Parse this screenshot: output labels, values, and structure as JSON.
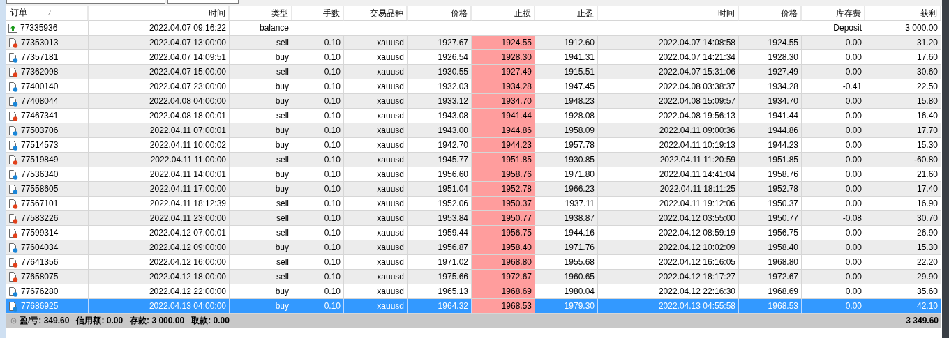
{
  "columns": [
    "订单",
    "时间",
    "类型",
    "手数",
    "交易品种",
    "价格",
    "止损",
    "止盈",
    "时间",
    "价格",
    "库存费",
    "获利"
  ],
  "rows": [
    {
      "kind": "balance",
      "selected": false,
      "order": "77335936",
      "open_time": "2022.04.07 09:16:22",
      "type": "balance",
      "comment": "Deposit",
      "profit": "3 000.00"
    },
    {
      "kind": "sell",
      "selected": false,
      "order": "77353013",
      "open_time": "2022.04.07 13:00:00",
      "type": "sell",
      "volume": "0.10",
      "symbol": "xauusd",
      "open_price": "1927.67",
      "stop_loss": "1924.55",
      "take_profit": "1912.60",
      "close_time": "2022.04.07 14:08:58",
      "close_price": "1924.55",
      "swap": "0.00",
      "profit": "31.20"
    },
    {
      "kind": "buy",
      "selected": false,
      "order": "77357181",
      "open_time": "2022.04.07 14:09:51",
      "type": "buy",
      "volume": "0.10",
      "symbol": "xauusd",
      "open_price": "1926.54",
      "stop_loss": "1928.30",
      "take_profit": "1941.31",
      "close_time": "2022.04.07 14:21:34",
      "close_price": "1928.30",
      "swap": "0.00",
      "profit": "17.60"
    },
    {
      "kind": "sell",
      "selected": false,
      "order": "77362098",
      "open_time": "2022.04.07 15:00:00",
      "type": "sell",
      "volume": "0.10",
      "symbol": "xauusd",
      "open_price": "1930.55",
      "stop_loss": "1927.49",
      "take_profit": "1915.51",
      "close_time": "2022.04.07 15:31:06",
      "close_price": "1927.49",
      "swap": "0.00",
      "profit": "30.60"
    },
    {
      "kind": "buy",
      "selected": false,
      "order": "77400140",
      "open_time": "2022.04.07 23:00:00",
      "type": "buy",
      "volume": "0.10",
      "symbol": "xauusd",
      "open_price": "1932.03",
      "stop_loss": "1934.28",
      "take_profit": "1947.45",
      "close_time": "2022.04.08 03:38:37",
      "close_price": "1934.28",
      "swap": "-0.41",
      "profit": "22.50"
    },
    {
      "kind": "buy",
      "selected": false,
      "order": "77408044",
      "open_time": "2022.04.08 04:00:00",
      "type": "buy",
      "volume": "0.10",
      "symbol": "xauusd",
      "open_price": "1933.12",
      "stop_loss": "1934.70",
      "take_profit": "1948.23",
      "close_time": "2022.04.08 15:09:57",
      "close_price": "1934.70",
      "swap": "0.00",
      "profit": "15.80"
    },
    {
      "kind": "sell",
      "selected": false,
      "order": "77467341",
      "open_time": "2022.04.08 18:00:01",
      "type": "sell",
      "volume": "0.10",
      "symbol": "xauusd",
      "open_price": "1943.08",
      "stop_loss": "1941.44",
      "take_profit": "1928.08",
      "close_time": "2022.04.08 19:56:13",
      "close_price": "1941.44",
      "swap": "0.00",
      "profit": "16.40"
    },
    {
      "kind": "buy",
      "selected": false,
      "order": "77503706",
      "open_time": "2022.04.11 07:00:01",
      "type": "buy",
      "volume": "0.10",
      "symbol": "xauusd",
      "open_price": "1943.00",
      "stop_loss": "1944.86",
      "take_profit": "1958.09",
      "close_time": "2022.04.11 09:00:36",
      "close_price": "1944.86",
      "swap": "0.00",
      "profit": "17.70"
    },
    {
      "kind": "buy",
      "selected": false,
      "order": "77514573",
      "open_time": "2022.04.11 10:00:02",
      "type": "buy",
      "volume": "0.10",
      "symbol": "xauusd",
      "open_price": "1942.70",
      "stop_loss": "1944.23",
      "take_profit": "1957.78",
      "close_time": "2022.04.11 10:19:13",
      "close_price": "1944.23",
      "swap": "0.00",
      "profit": "15.30"
    },
    {
      "kind": "sell",
      "selected": false,
      "order": "77519849",
      "open_time": "2022.04.11 11:00:00",
      "type": "sell",
      "volume": "0.10",
      "symbol": "xauusd",
      "open_price": "1945.77",
      "stop_loss": "1951.85",
      "take_profit": "1930.85",
      "close_time": "2022.04.11 11:20:59",
      "close_price": "1951.85",
      "swap": "0.00",
      "profit": "-60.80"
    },
    {
      "kind": "buy",
      "selected": false,
      "order": "77536340",
      "open_time": "2022.04.11 14:00:01",
      "type": "buy",
      "volume": "0.10",
      "symbol": "xauusd",
      "open_price": "1956.60",
      "stop_loss": "1958.76",
      "take_profit": "1971.80",
      "close_time": "2022.04.11 14:41:04",
      "close_price": "1958.76",
      "swap": "0.00",
      "profit": "21.60"
    },
    {
      "kind": "buy",
      "selected": false,
      "order": "77558605",
      "open_time": "2022.04.11 17:00:00",
      "type": "buy",
      "volume": "0.10",
      "symbol": "xauusd",
      "open_price": "1951.04",
      "stop_loss": "1952.78",
      "take_profit": "1966.23",
      "close_time": "2022.04.11 18:11:25",
      "close_price": "1952.78",
      "swap": "0.00",
      "profit": "17.40"
    },
    {
      "kind": "sell",
      "selected": false,
      "order": "77567101",
      "open_time": "2022.04.11 18:12:39",
      "type": "sell",
      "volume": "0.10",
      "symbol": "xauusd",
      "open_price": "1952.06",
      "stop_loss": "1950.37",
      "take_profit": "1937.11",
      "close_time": "2022.04.11 19:12:06",
      "close_price": "1950.37",
      "swap": "0.00",
      "profit": "16.90"
    },
    {
      "kind": "sell",
      "selected": false,
      "order": "77583226",
      "open_time": "2022.04.11 23:00:00",
      "type": "sell",
      "volume": "0.10",
      "symbol": "xauusd",
      "open_price": "1953.84",
      "stop_loss": "1950.77",
      "take_profit": "1938.87",
      "close_time": "2022.04.12 03:55:00",
      "close_price": "1950.77",
      "swap": "-0.08",
      "profit": "30.70"
    },
    {
      "kind": "sell",
      "selected": false,
      "order": "77599314",
      "open_time": "2022.04.12 07:00:01",
      "type": "sell",
      "volume": "0.10",
      "symbol": "xauusd",
      "open_price": "1959.44",
      "stop_loss": "1956.75",
      "take_profit": "1944.16",
      "close_time": "2022.04.12 08:59:19",
      "close_price": "1956.75",
      "swap": "0.00",
      "profit": "26.90"
    },
    {
      "kind": "buy",
      "selected": false,
      "order": "77604034",
      "open_time": "2022.04.12 09:00:00",
      "type": "buy",
      "volume": "0.10",
      "symbol": "xauusd",
      "open_price": "1956.87",
      "stop_loss": "1958.40",
      "take_profit": "1971.76",
      "close_time": "2022.04.12 10:02:09",
      "close_price": "1958.40",
      "swap": "0.00",
      "profit": "15.30"
    },
    {
      "kind": "sell",
      "selected": false,
      "order": "77641356",
      "open_time": "2022.04.12 16:00:00",
      "type": "sell",
      "volume": "0.10",
      "symbol": "xauusd",
      "open_price": "1971.02",
      "stop_loss": "1968.80",
      "take_profit": "1955.68",
      "close_time": "2022.04.12 16:16:05",
      "close_price": "1968.80",
      "swap": "0.00",
      "profit": "22.20"
    },
    {
      "kind": "sell",
      "selected": false,
      "order": "77658075",
      "open_time": "2022.04.12 18:00:00",
      "type": "sell",
      "volume": "0.10",
      "symbol": "xauusd",
      "open_price": "1975.66",
      "stop_loss": "1972.67",
      "take_profit": "1960.65",
      "close_time": "2022.04.12 18:17:27",
      "close_price": "1972.67",
      "swap": "0.00",
      "profit": "29.90"
    },
    {
      "kind": "buy",
      "selected": false,
      "order": "77676280",
      "open_time": "2022.04.12 22:00:00",
      "type": "buy",
      "volume": "0.10",
      "symbol": "xauusd",
      "open_price": "1965.13",
      "stop_loss": "1968.69",
      "take_profit": "1980.04",
      "close_time": "2022.04.12 22:16:30",
      "close_price": "1968.69",
      "swap": "0.00",
      "profit": "35.60"
    },
    {
      "kind": "buy",
      "selected": true,
      "order": "77686925",
      "open_time": "2022.04.13 04:00:00",
      "type": "buy",
      "volume": "0.10",
      "symbol": "xauusd",
      "open_price": "1964.32",
      "stop_loss": "1968.53",
      "take_profit": "1979.30",
      "close_time": "2022.04.13 04:55:58",
      "close_price": "1968.53",
      "swap": "0.00",
      "profit": "42.10"
    }
  ],
  "summary": {
    "items": [
      {
        "label": "盈/亏:",
        "value": "349.60"
      },
      {
        "label": "信用额:",
        "value": "0.00"
      },
      {
        "label": "存款:",
        "value": "3 000.00"
      },
      {
        "label": "取款:",
        "value": "0.00"
      }
    ],
    "total": "3 349.60"
  }
}
